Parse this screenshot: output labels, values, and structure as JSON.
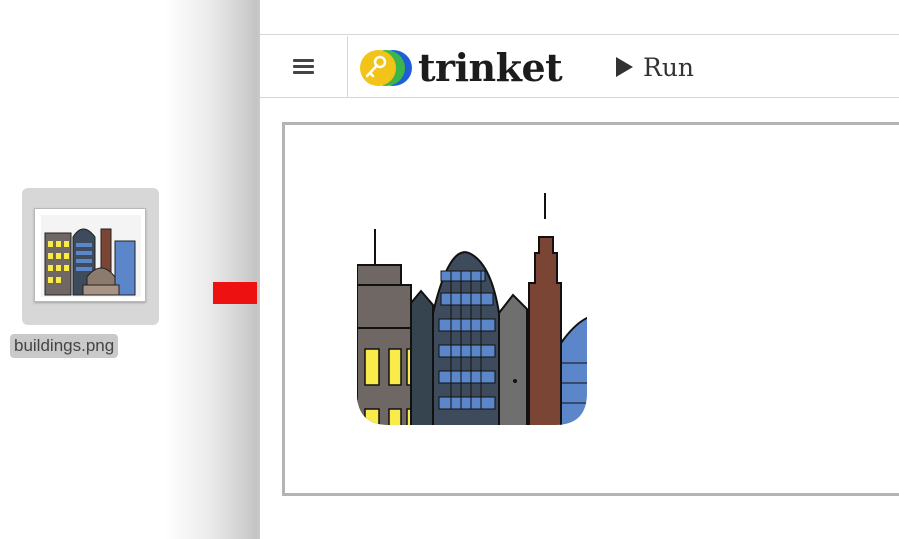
{
  "desktop": {
    "file": {
      "name": "buildings.png",
      "icon": "image-file-thumbnail-icon"
    }
  },
  "annotation": {
    "arrow_color": "#ee1111",
    "icon": "right-arrow-icon"
  },
  "app": {
    "brand": "trinket",
    "logo_icon": "trinket-key-logo-icon",
    "menu_icon": "hamburger-menu-icon",
    "run_label": "Run",
    "run_icon": "play-icon"
  },
  "output": {
    "image": "buildings-sprite"
  },
  "colors": {
    "logo_yellow": "#f2c318",
    "logo_green": "#3cb54a",
    "logo_blue": "#1e5fd8",
    "building_gray": "#6e6764",
    "building_brick": "#7a4534",
    "window_yellow": "#f9ec4a",
    "glass_blue": "#5b86c9"
  }
}
